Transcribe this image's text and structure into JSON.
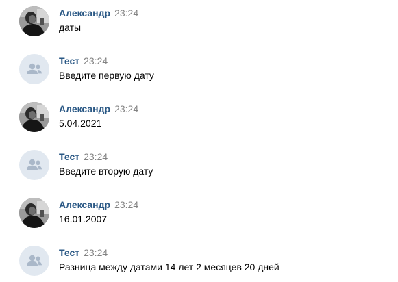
{
  "colors": {
    "author": "#2a5885",
    "time": "#828282",
    "text": "#000000",
    "bot_avatar_bg": "#e1e8f0",
    "bot_avatar_icon": "#aab8c9"
  },
  "messages": [
    {
      "author": "Александр",
      "time": "23:24",
      "text": "даты",
      "avatar": "user-photo"
    },
    {
      "author": "Тест",
      "time": "23:24",
      "text": "Введите первую дату",
      "avatar": "users-icon"
    },
    {
      "author": "Александр",
      "time": "23:24",
      "text": "5.04.2021",
      "avatar": "user-photo"
    },
    {
      "author": "Тест",
      "time": "23:24",
      "text": "Введите вторую дату",
      "avatar": "users-icon"
    },
    {
      "author": "Александр",
      "time": "23:24",
      "text": "16.01.2007",
      "avatar": "user-photo"
    },
    {
      "author": "Тест",
      "time": "23:24",
      "text": "Разница между датами 14 лет 2 месяцев 20 дней",
      "avatar": "users-icon"
    }
  ]
}
